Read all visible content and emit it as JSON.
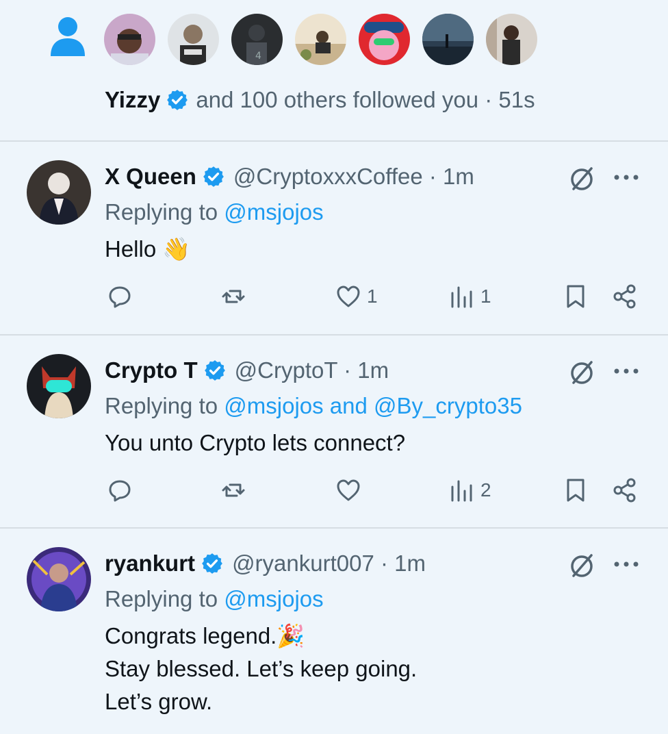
{
  "follow_notification": {
    "name": "Yizzy",
    "rest": "and 100 others followed you · 51s",
    "avatars": [
      "follower-avatar-1",
      "follower-avatar-2",
      "follower-avatar-3",
      "follower-avatar-4",
      "follower-avatar-5",
      "follower-avatar-6",
      "follower-avatar-7"
    ]
  },
  "replies": [
    {
      "display_name": "X Queen",
      "handle_time": "@CryptoxxxCoffee · 1m",
      "replying_prefix": "Replying to",
      "replying_to": "@msjojos",
      "text": "Hello 👋",
      "likes": "1",
      "views": "1"
    },
    {
      "display_name": "Crypto T",
      "handle_time": "@CryptoT · 1m",
      "replying_prefix": "Replying to",
      "replying_to": "@msjojos and @By_crypto35",
      "text": "You unto Crypto lets connect?",
      "likes": "",
      "views": "2"
    },
    {
      "display_name": "ryankurt",
      "handle_time": "@ryankurt007 · 1m",
      "replying_prefix": "Replying to",
      "replying_to": "@msjojos",
      "text": "Congrats legend.🎉\nStay blessed. Let’s keep going.\nLet’s grow.",
      "likes": "",
      "views": ""
    }
  ],
  "colors": {
    "background": "#eef5fb",
    "accent": "#1d9bf0",
    "muted": "#536471",
    "text": "#0f1419"
  }
}
